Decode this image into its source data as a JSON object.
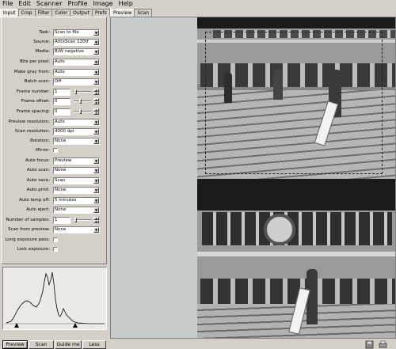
{
  "menu": [
    "File",
    "Edit",
    "Scanner",
    "Profile",
    "Image",
    "Help"
  ],
  "left_tabs": [
    "Input",
    "Crop",
    "Filter",
    "Color",
    "Output",
    "Prefs"
  ],
  "right_tabs": [
    "Preview",
    "Scan"
  ],
  "fields": {
    "task": {
      "label": "Task:",
      "value": "Scan to file"
    },
    "source": {
      "label": "Source:",
      "value": "ArtixScan 120tf"
    },
    "media": {
      "label": "Media:",
      "value": "B/W negative"
    },
    "bits": {
      "label": "Bits per pixel:",
      "value": "Auto"
    },
    "gray": {
      "label": "Make gray from:",
      "value": "Auto"
    },
    "batch": {
      "label": "Batch scan:",
      "value": "Off"
    },
    "frame_number": {
      "label": "Frame number:",
      "value": "1"
    },
    "frame_offset": {
      "label": "Frame offset:",
      "value": "0"
    },
    "frame_spacing": {
      "label": "Frame spacing:",
      "value": "0"
    },
    "preview_res": {
      "label": "Preview resolution:",
      "value": "Auto"
    },
    "scan_res": {
      "label": "Scan resolution:",
      "value": "4000 dpi"
    },
    "rotation": {
      "label": "Rotation:",
      "value": "None"
    },
    "mirror": {
      "label": "Mirror:"
    },
    "auto_focus": {
      "label": "Auto focus:",
      "value": "Preview"
    },
    "auto_scan": {
      "label": "Auto scan:",
      "value": "None"
    },
    "auto_save": {
      "label": "Auto save:",
      "value": "Scan"
    },
    "auto_print": {
      "label": "Auto print:",
      "value": "None"
    },
    "lamp_off": {
      "label": "Auto lamp off:",
      "value": "5 minutes"
    },
    "auto_eject": {
      "label": "Auto eject:",
      "value": "None"
    },
    "num_samples": {
      "label": "Number of samples:",
      "value": "1"
    },
    "scan_from_preview": {
      "label": "Scan from preview:",
      "value": "None"
    },
    "long_exposure": {
      "label": "Long exposure pass:"
    },
    "lock_exposure": {
      "label": "Lock exposure:"
    }
  },
  "bottom_buttons": {
    "preview": "Preview",
    "scan": "Scan",
    "guide": "Guide me",
    "less": "Less"
  }
}
